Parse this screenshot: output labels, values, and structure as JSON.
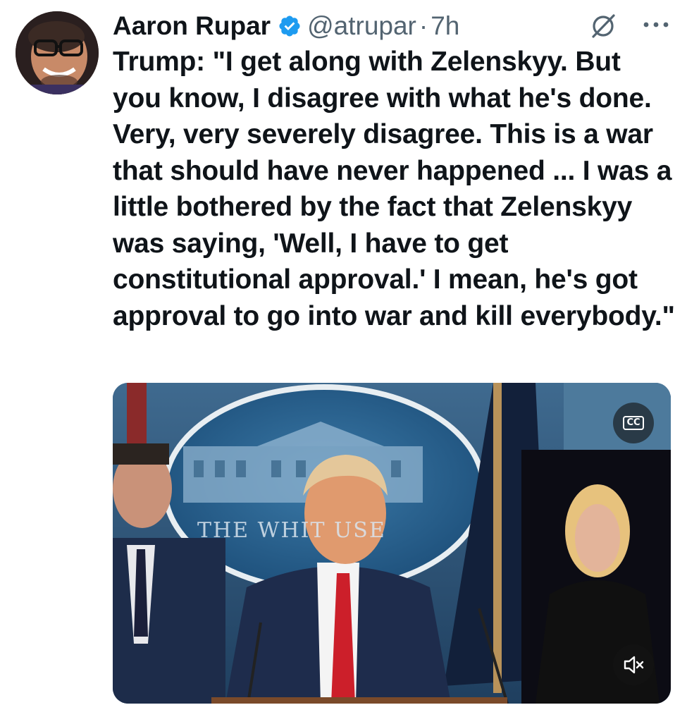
{
  "author": {
    "name": "Aaron Rupar",
    "handle": "@atrupar",
    "separator": "·",
    "time": "7h",
    "verified": true
  },
  "tweet": {
    "text": "Trump: \"I get along with Zelenskyy. But you know, I disagree with what he's done. Very, very severely disagree. This is a war that should have never happened ... I was a little bothered by the fact that Zelenskyy was saying, 'Well, I have to get constitutional approval.' I mean, he's got approval to go into war and kill everybody.\""
  },
  "media": {
    "type": "video",
    "seal_text": "THE WHIT      USE",
    "cc_label": "CC",
    "muted": true
  },
  "icons": {
    "verified": "verified-badge-icon",
    "grok": "grok-icon",
    "more": "more-options-icon",
    "captions": "closed-captions-icon",
    "mute": "speaker-muted-icon"
  },
  "colors": {
    "verified": "#1d9bf0",
    "text": "#0f1419",
    "secondary": "#536471"
  }
}
